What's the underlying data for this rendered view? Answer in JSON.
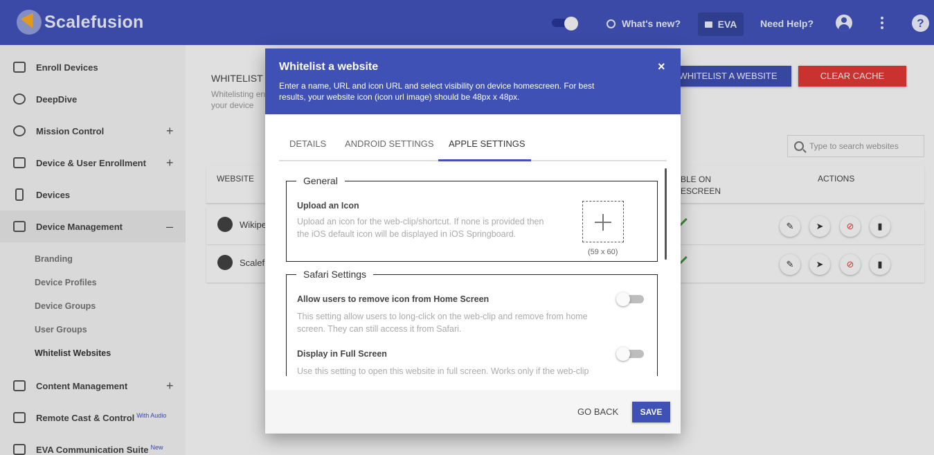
{
  "brand": {
    "name": "Scalefusion"
  },
  "topbar": {
    "whats_new": "What's new?",
    "eva": "EVA",
    "need_help": "Need Help?",
    "help_icon": "?"
  },
  "sidebar": {
    "items": [
      {
        "label": "Enroll Devices",
        "icon": "enroll-devices-icon"
      },
      {
        "label": "DeepDive",
        "icon": "deepdive-icon"
      },
      {
        "label": "Mission Control",
        "icon": "mission-control-icon",
        "expand": "+"
      },
      {
        "label": "Device & User Enrollment",
        "icon": "enrollment-icon",
        "expand": "+"
      },
      {
        "label": "Devices",
        "icon": "devices-icon"
      },
      {
        "label": "Device Management",
        "icon": "device-management-icon",
        "expand": "–"
      },
      {
        "label": "Content Management",
        "icon": "content-management-icon",
        "expand": "+"
      },
      {
        "label": "Remote Cast & Control",
        "icon": "remote-cast-icon",
        "badge": "With Audio"
      },
      {
        "label": "EVA Communication Suite",
        "icon": "eva-suite-icon",
        "badge": "New"
      }
    ],
    "sub_items": [
      "Branding",
      "Device Profiles",
      "Device Groups",
      "User Groups",
      "Whitelist Websites"
    ]
  },
  "page": {
    "title": "WHITELIST W",
    "subtitle": "Whitelisting en your device",
    "whitelist_button": "WHITELIST A WEBSITE",
    "clear_cache_button": "CLEAR CACHE",
    "search_placeholder": "Type to search websites",
    "columns": {
      "website": "WEBSITE",
      "visible": "BLE ON ESCREEN",
      "actions": "ACTIONS"
    },
    "rows": [
      {
        "name": "Wikipe"
      },
      {
        "name": "Scalefu"
      }
    ]
  },
  "modal": {
    "title": "Whitelist a website",
    "description": "Enter a name, URL and icon URL and select visibility on device homescreen. For best results, your website icon (icon url image) should be 48px x 48px.",
    "close": "×",
    "tabs": [
      "DETAILS",
      "ANDROID SETTINGS",
      "APPLE SETTINGS"
    ],
    "active_tab": "APPLE SETTINGS",
    "general": {
      "legend": "General",
      "upload_title": "Upload an Icon",
      "upload_text": "Upload an icon for the web-clip/shortcut. If none is provided then the iOS default icon will be displayed in iOS Springboard.",
      "upload_size": "(59 x 60)"
    },
    "safari": {
      "legend": "Safari Settings",
      "allow_remove_title": "Allow users to remove icon from Home Screen",
      "allow_remove_text": "This setting allow users to long-click on the web-clip and remove from home screen. They can still access it from Safari.",
      "allow_remove_on": false,
      "full_screen_title": "Display in Full Screen",
      "full_screen_text": "Use this setting to open this website in full screen. Works only if the web-clip is visible on home screen.",
      "full_screen_on": false
    },
    "go_back": "GO BACK",
    "save": "SAVE"
  }
}
